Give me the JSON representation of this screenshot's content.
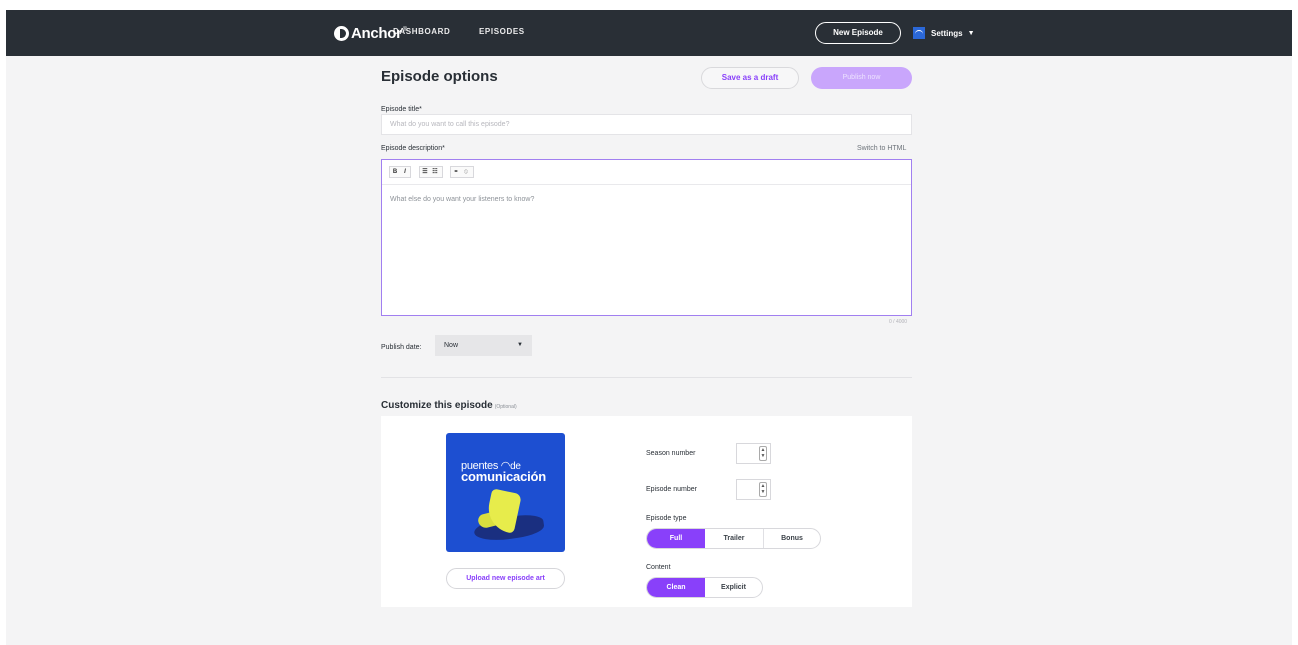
{
  "colors": {
    "topbar": "#292f36",
    "accent": "#8940fa",
    "publish_disabled": "#c9a6fc",
    "background": "#f4f4f5"
  },
  "topbar": {
    "logo_text": "Anchor",
    "logo_mark": "®",
    "nav": [
      "DASHBOARD",
      "EPISODES"
    ],
    "new_episode_label": "New Episode",
    "settings_label": "Settings"
  },
  "page": {
    "title": "Episode options",
    "save_draft_label": "Save as a draft",
    "publish_now_label": "Publish now"
  },
  "form": {
    "title_label": "Episode title*",
    "title_placeholder": "What do you want to call this episode?",
    "description_label": "Episode description*",
    "switch_html_label": "Switch to HTML",
    "editor_toolbar": [
      "B",
      "I",
      "ul",
      "ol",
      "link",
      "unlink"
    ],
    "description_placeholder": "What else do you want your listeners to know?",
    "char_counter": "0 / 4000",
    "publish_date_label": "Publish date:",
    "publish_date_value": "Now"
  },
  "customize": {
    "heading": "Customize this episode",
    "optional": "(Optional)",
    "art_line1": "puentes",
    "art_line1b": "de",
    "art_line2": "comunicación",
    "upload_label": "Upload new episode art",
    "season_label": "Season number",
    "episode_label": "Episode number",
    "episode_type_label": "Episode type",
    "episode_types": [
      "Full",
      "Trailer",
      "Bonus"
    ],
    "episode_type_selected": "Full",
    "content_label": "Content",
    "content_options": [
      "Clean",
      "Explicit"
    ],
    "content_selected": "Clean"
  }
}
